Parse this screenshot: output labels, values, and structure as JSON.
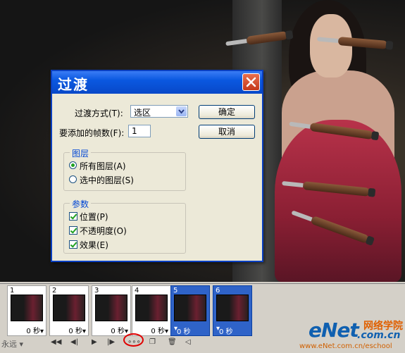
{
  "dialog": {
    "title": "过渡",
    "tween_with_label": "过渡方式(T):",
    "tween_with_value": "选区",
    "frames_to_add_label": "要添加的帧数(F):",
    "frames_to_add_value": "1",
    "ok_label": "确定",
    "cancel_label": "取消",
    "layers_group": {
      "title": "图层",
      "options": [
        {
          "label": "所有图层(A)",
          "selected": true
        },
        {
          "label": "选中的图层(S)",
          "selected": false
        }
      ]
    },
    "params_group": {
      "title": "参数",
      "options": [
        {
          "label": "位置(P)",
          "checked": true
        },
        {
          "label": "不透明度(O)",
          "checked": true
        },
        {
          "label": "效果(E)",
          "checked": true
        }
      ]
    }
  },
  "animation_panel": {
    "frames": [
      {
        "number": "1",
        "delay": "0 秒",
        "selected": false
      },
      {
        "number": "2",
        "delay": "0 秒",
        "selected": false
      },
      {
        "number": "3",
        "delay": "0 秒",
        "selected": false
      },
      {
        "number": "4",
        "delay": "0 秒",
        "selected": false
      },
      {
        "number": "5",
        "delay": "0 秒",
        "selected": true
      },
      {
        "number": "6",
        "delay": "0 秒",
        "selected": true
      }
    ],
    "loop_option": "永远"
  },
  "watermark": {
    "logo": "eNet",
    "suffix": ".com.cn",
    "cn_text": "网络学院",
    "url": "www.eNet.com.cn/eschool"
  },
  "colors": {
    "title_bar": "#0a58e0",
    "close_button": "#c3381a",
    "selected_frame": "#2f63c8",
    "highlight_circle": "#e00000"
  }
}
